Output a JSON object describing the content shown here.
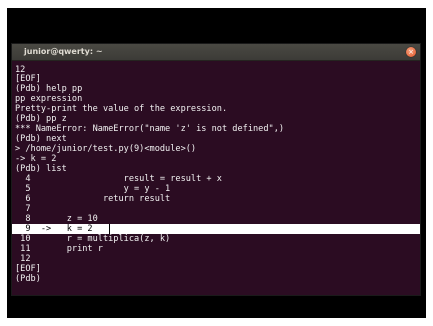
{
  "window": {
    "title": "junior@qwerty: ~",
    "close_glyph": "×"
  },
  "terminal": {
    "lines": [
      "12",
      "[EOF]",
      "(Pdb) help pp",
      "pp expression",
      "Pretty-print the value of the expression.",
      "(Pdb) pp z",
      "*** NameError: NameError(\"name 'z' is not defined\",)",
      "(Pdb) next",
      "> /home/junior/test.py(9)<module>()",
      "-> k = 2",
      "(Pdb) list",
      "  4                  result = result + x",
      "  5                  y = y - 1",
      "  6              return result",
      "  7",
      "  8       z = 10",
      "  9  ->   k = 2",
      " 10       r = multiplica(z, k)",
      " 11       print r",
      " 12",
      "[EOF]",
      "(Pdb)"
    ],
    "highlighted_line_index": 16
  }
}
